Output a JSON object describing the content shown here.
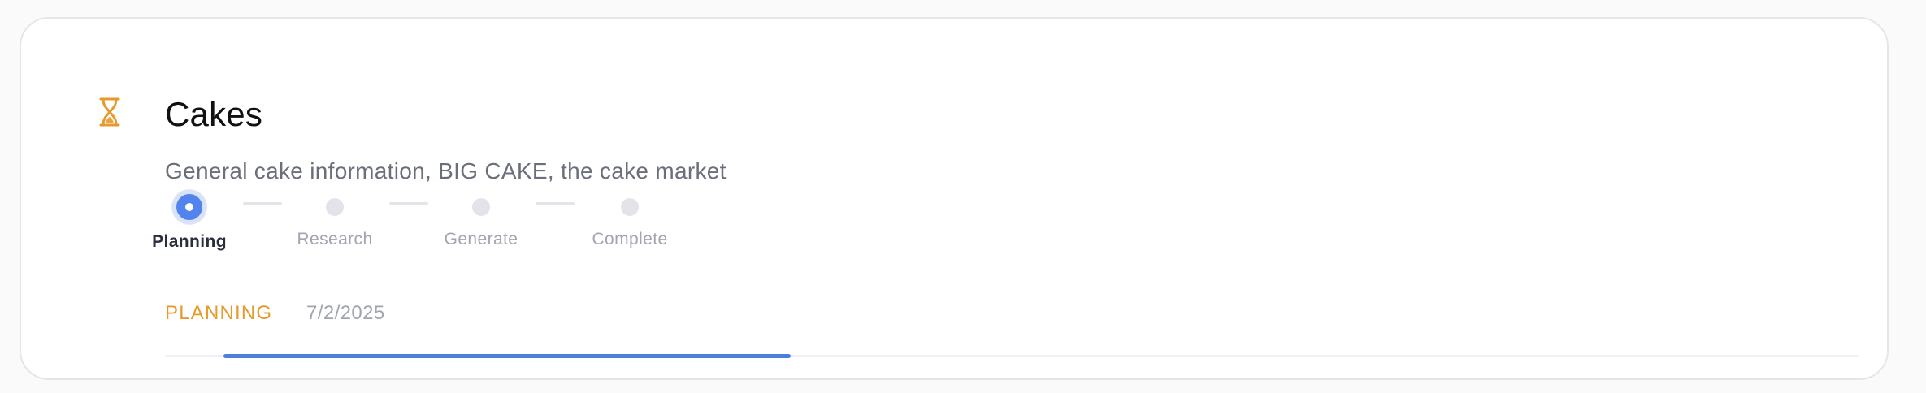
{
  "card": {
    "icon": "hourglass-icon",
    "title": "Cakes",
    "subtitle": "General cake information, BIG CAKE, the cake market"
  },
  "steps": [
    {
      "label": "Planning",
      "state": "active"
    },
    {
      "label": "Research",
      "state": "pending"
    },
    {
      "label": "Generate",
      "state": "pending"
    },
    {
      "label": "Complete",
      "state": "pending"
    }
  ],
  "status": {
    "label": "PLANNING",
    "date": "7/2/2025"
  },
  "progress": {
    "fraction": 0.335
  },
  "colors": {
    "accent_orange": "#e79a2c",
    "accent_blue": "#4a7fe0",
    "step_active": "#5384ee",
    "muted_text": "#a2a5b0"
  }
}
